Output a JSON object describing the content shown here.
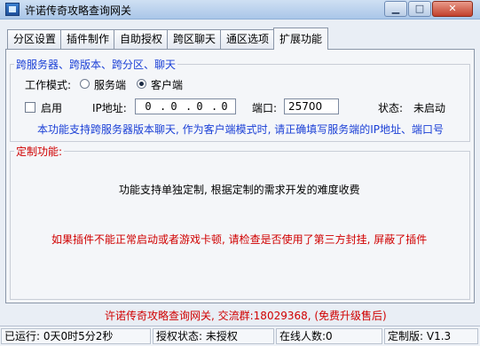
{
  "window": {
    "title": "许诺传奇攻略查询网关",
    "min": "▁",
    "max": "□",
    "close": "✕"
  },
  "tabs": [
    "分区设置",
    "插件制作",
    "自助授权",
    "跨区聊天",
    "通区选项",
    "扩展功能"
  ],
  "cross": {
    "group_title": "跨服务器、跨版本、跨分区、聊天",
    "mode_label": "工作模式:",
    "mode_server": "服务端",
    "mode_client": "客户端",
    "enable_label": "启用",
    "ip_label": "IP地址:",
    "ip": [
      "0",
      "0",
      "0",
      "0"
    ],
    "port_label": "端口:",
    "port_value": "25700",
    "status_label": "状态:",
    "status_value": "未启动",
    "note": "本功能支持跨服务器版本聊天, 作为客户端模式时, 请正确填写服务端的IP地址、端口号"
  },
  "custom": {
    "group_title": "定制功能:",
    "line1": "功能支持单独定制, 根据定制的需求开发的难度收费",
    "line2": "如果插件不能正常启动或者游戏卡顿, 请检查是否使用了第三方封挂, 屏蔽了插件"
  },
  "footer_contact": "许诺传奇攻略查询网关, 交流群:18029368, (免费升级售后)",
  "statusbar": {
    "runtime": "已运行: 0天0时5分2秒",
    "auth": "授权状态: 未授权",
    "online": "在线人数:0",
    "version": "定制版: V1.3"
  },
  "colors": {
    "accent": "#1a3fd6",
    "warning": "#d00000"
  }
}
